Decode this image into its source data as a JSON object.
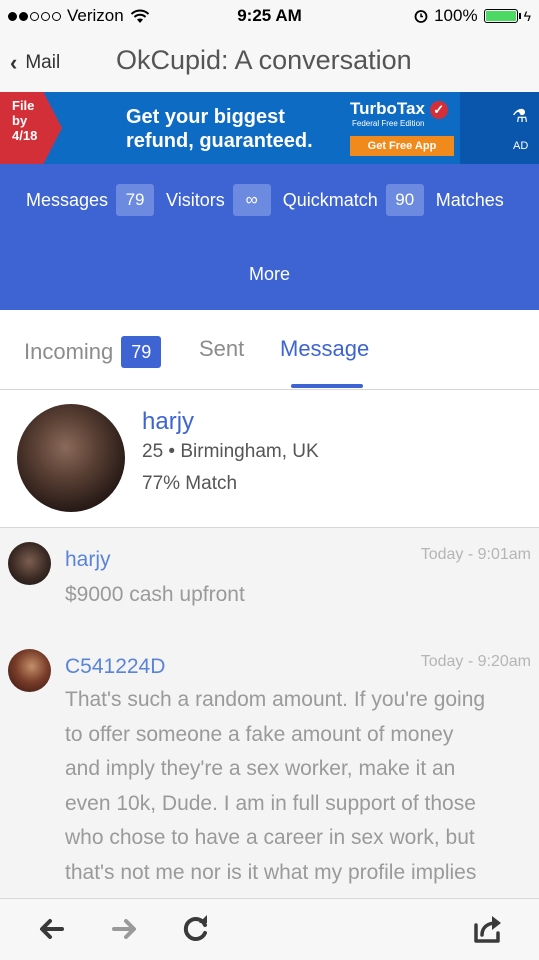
{
  "status": {
    "carrier": "Verizon",
    "time": "9:25 AM",
    "battery": "100%"
  },
  "nav": {
    "back_label": "Mail",
    "title": "OkCupid: A conversation"
  },
  "ad": {
    "file_by": "File\nby\n4/18",
    "headline_line1": "Get your biggest",
    "headline_line2": "refund, guaranteed.",
    "brand": "TurboTax",
    "edition": "Federal Free Edition",
    "cta": "Get Free App",
    "ad_label": "AD"
  },
  "tabs": {
    "messages_label": "Messages",
    "messages_count": "79",
    "visitors_label": "Visitors",
    "visitors_count": "∞",
    "quickmatch_label": "Quickmatch",
    "quickmatch_count": "90",
    "matches_label": "Matches",
    "more_label": "More"
  },
  "subtabs": {
    "incoming_label": "Incoming",
    "incoming_count": "79",
    "sent_label": "Sent",
    "message_label": "Message"
  },
  "profile": {
    "name": "harjy",
    "info": "25 • Birmingham, UK",
    "match": "77% Match"
  },
  "messages": [
    {
      "author": "harjy",
      "timestamp": "Today - 9:01am",
      "lines": [
        "$9000 cash upfront"
      ]
    },
    {
      "author": "C541224D",
      "timestamp": "Today - 9:20am",
      "lines": [
        "That's such a random amount. If you're going",
        "to offer someone a fake amount of money",
        "and imply they're a sex worker, make it an",
        "even 10k, Dude. I am in full support of those",
        "who chose to have a career in sex work, but",
        "that's not me nor is it what my profile implies"
      ]
    }
  ],
  "icons": {
    "toolbar": [
      "back-arrow-icon",
      "forward-arrow-icon",
      "reload-icon",
      "share-icon"
    ]
  },
  "colors": {
    "brand_blue": "#3e64d3",
    "link_blue": "#5a84d6"
  }
}
